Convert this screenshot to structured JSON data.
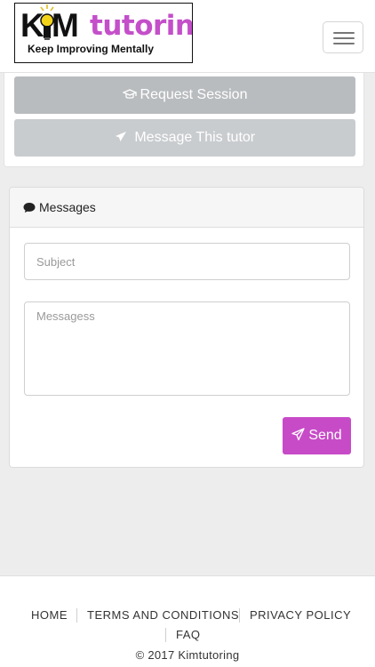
{
  "brand": {
    "logo_text_k": "K",
    "logo_text_m": "M",
    "logo_text_word": "tutoring",
    "tagline": "Keep Improving Mentally",
    "accent_color": "#c44fc9"
  },
  "navbar": {
    "toggle_icon": "hamburger-menu-icon"
  },
  "actions": {
    "request_session": {
      "label": "Request Session",
      "icon": "graduation-cap-icon"
    },
    "message_tutor": {
      "label": "Message This tutor",
      "icon": "paper-plane-icon"
    }
  },
  "messages": {
    "header": "Messages",
    "header_icon": "comment-icon",
    "subject_placeholder": "Subject",
    "message_placeholder": "Messagess",
    "send_label": "Send",
    "send_icon": "paper-plane-icon",
    "send_color": "#c74bc7"
  },
  "footer": {
    "links": [
      "HOME",
      "TERMS AND CONDITIONS",
      "PRIVACY POLICY",
      "FAQ"
    ],
    "copyright": "© 2017 Kimtutoring"
  }
}
